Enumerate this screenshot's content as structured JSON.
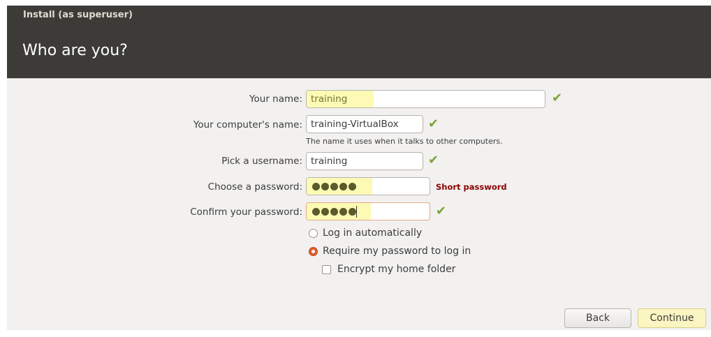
{
  "window": {
    "title": "Install (as superuser)"
  },
  "page": {
    "title": "Who are you?"
  },
  "form": {
    "name_label": "Your name:",
    "name_value": "training",
    "computer_label": "Your computer's name:",
    "computer_value": "training-VirtualBox",
    "computer_hint": "The name it uses when it talks to other computers.",
    "username_label": "Pick a username:",
    "username_value": "training",
    "password_label": "Choose a password:",
    "password_strength": "Short password",
    "confirm_label": "Confirm your password:",
    "login_auto_label": "Log in automatically",
    "login_require_label": "Require my password to log in",
    "encrypt_label": "Encrypt my home folder",
    "selected_login_option": "Require my password to log in",
    "encrypt_checked": false
  },
  "icons": {
    "valid": "checkmark-icon"
  },
  "colors": {
    "header_bg": "#3c3b37",
    "accent_orange": "#e05d2c",
    "check_green": "#7aa33a",
    "warning_red": "#8b0000",
    "highlight_yellow": "#fcfab4"
  },
  "buttons": {
    "back": "Back",
    "continue": "Continue"
  }
}
